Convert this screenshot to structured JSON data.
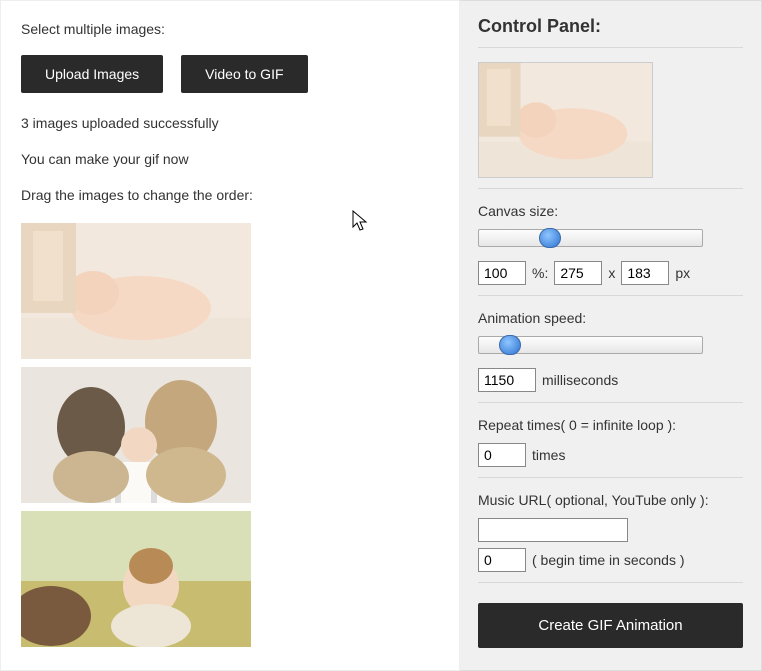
{
  "left": {
    "select_label": "Select multiple images:",
    "upload_btn": "Upload Images",
    "video_btn": "Video to GIF",
    "status_uploaded": "3 images uploaded successfully",
    "status_ready": "You can make your gif now",
    "drag_label": "Drag the images to change the order:"
  },
  "cp": {
    "title": "Control Panel:",
    "canvas_label": "Canvas size:",
    "canvas_percent": "100",
    "percent_suffix": "%:",
    "canvas_w": "275",
    "x_sep": "x",
    "canvas_h": "183",
    "px_suffix": "px",
    "speed_label": "Animation speed:",
    "speed_value": "1150",
    "speed_unit": "milliseconds",
    "repeat_label": "Repeat times( 0 = infinite loop ):",
    "repeat_value": "0",
    "repeat_unit": "times",
    "music_label": "Music URL( optional, YouTube only ):",
    "music_value": "",
    "begin_value": "0",
    "begin_label": "( begin time in seconds )",
    "create_btn": "Create GIF Animation"
  }
}
